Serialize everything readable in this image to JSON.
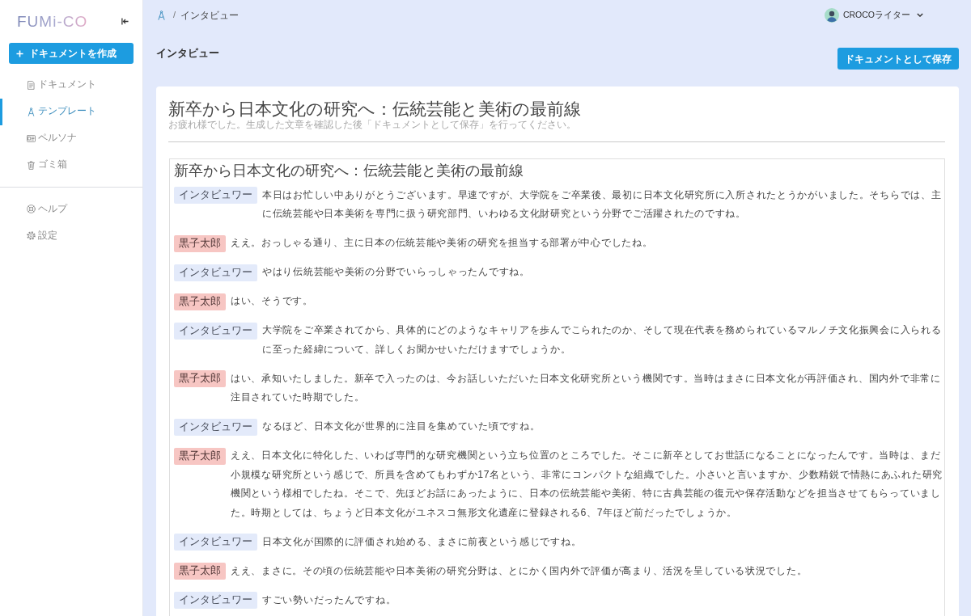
{
  "sidebar": {
    "logo": "FUMi-CO",
    "create_button": {
      "label": "ドキュメントを作成"
    },
    "nav": [
      {
        "label": "ドキュメント",
        "selected": false
      },
      {
        "label": "テンプレート",
        "selected": true
      },
      {
        "label": "ペルソナ",
        "selected": false
      },
      {
        "label": "ゴミ箱",
        "selected": false
      }
    ],
    "footer_nav": [
      {
        "label": "ヘルプ",
        "selected": false
      },
      {
        "label": "設定",
        "selected": false
      }
    ]
  },
  "header": {
    "breadcrumb": {
      "separator": "/",
      "current": "インタビュー"
    },
    "user": {
      "name": "CROCOライター"
    }
  },
  "page": {
    "title": "インタビュー",
    "save_button": {
      "label": "ドキュメントとして保存"
    }
  },
  "document": {
    "title": "新卒から日本文化の研究へ：伝統芸能と美術の最前線",
    "notice": "お疲れ様でした。生成した文章を確認した後「ドキュメントとして保存」を行ってください。",
    "transcript": {
      "title": "新卒から日本文化の研究へ：伝統芸能と美術の最前線",
      "entries": [
        {
          "kind": "interviewer",
          "speaker": "インタビュワー",
          "text": "本日はお忙しい中ありがとうございます。早速ですが、大学院をご卒業後、最初に日本文化研究所に入所されたとうかがいました。そちらでは、主に伝統芸能や日本美術を専門に扱う研究部門、いわゆる文化財研究という分野でご活躍されたのですね。"
        },
        {
          "kind": "guest",
          "speaker": "黒子太郎",
          "text": "ええ。おっしゃる通り、主に日本の伝統芸能や美術の研究を担当する部署が中心でしたね。"
        },
        {
          "kind": "interviewer",
          "speaker": "インタビュワー",
          "text": "やはり伝統芸能や美術の分野でいらっしゃったんですね。"
        },
        {
          "kind": "guest",
          "speaker": "黒子太郎",
          "text": "はい、そうです。"
        },
        {
          "kind": "interviewer",
          "speaker": "インタビュワー",
          "text": "大学院をご卒業されてから、具体的にどのようなキャリアを歩んでこられたのか、そして現在代表を務められているマルノチ文化振興会に入られるに至った経緯について、詳しくお聞かせいただけますでしょうか。"
        },
        {
          "kind": "guest",
          "speaker": "黒子太郎",
          "text": "はい、承知いたしました。新卒で入ったのは、今お話しいただいた日本文化研究所という機関です。当時はまさに日本文化が再評価され、国内外で非常に注目されていた時期でした。"
        },
        {
          "kind": "interviewer",
          "speaker": "インタビュワー",
          "text": "なるほど、日本文化が世界的に注目を集めていた頃ですね。"
        },
        {
          "kind": "guest",
          "speaker": "黒子太郎",
          "text": "ええ、日本文化に特化した、いわば専門的な研究機関という立ち位置のところでした。そこに新卒としてお世話になることになったんです。当時は、まだ小規模な研究所という感じで、所員を含めてもわずか17名という、非常にコンパクトな組織でした。小さいと言いますか、少数精鋭で情熱にあふれた研究機関という様相でしたね。そこで、先ほどお話にあったように、日本の伝統芸能や美術、特に古典芸能の復元や保存活動などを担当させてもらっていました。時期としては、ちょうど日本文化がユネスコ無形文化遺産に登録される6、7年ほど前だったでしょうか。"
        },
        {
          "kind": "interviewer",
          "speaker": "インタビュワー",
          "text": "日本文化が国際的に評価され始める、まさに前夜という感じですね。"
        },
        {
          "kind": "guest",
          "speaker": "黒子太郎",
          "text": "ええ、まさに。その頃の伝統芸能や日本美術の研究分野は、とにかく国内外で評価が高まり、活況を呈している状況でした。"
        },
        {
          "kind": "interviewer",
          "speaker": "インタビュワー",
          "text": "すごい勢いだったんですね。"
        }
      ]
    }
  }
}
